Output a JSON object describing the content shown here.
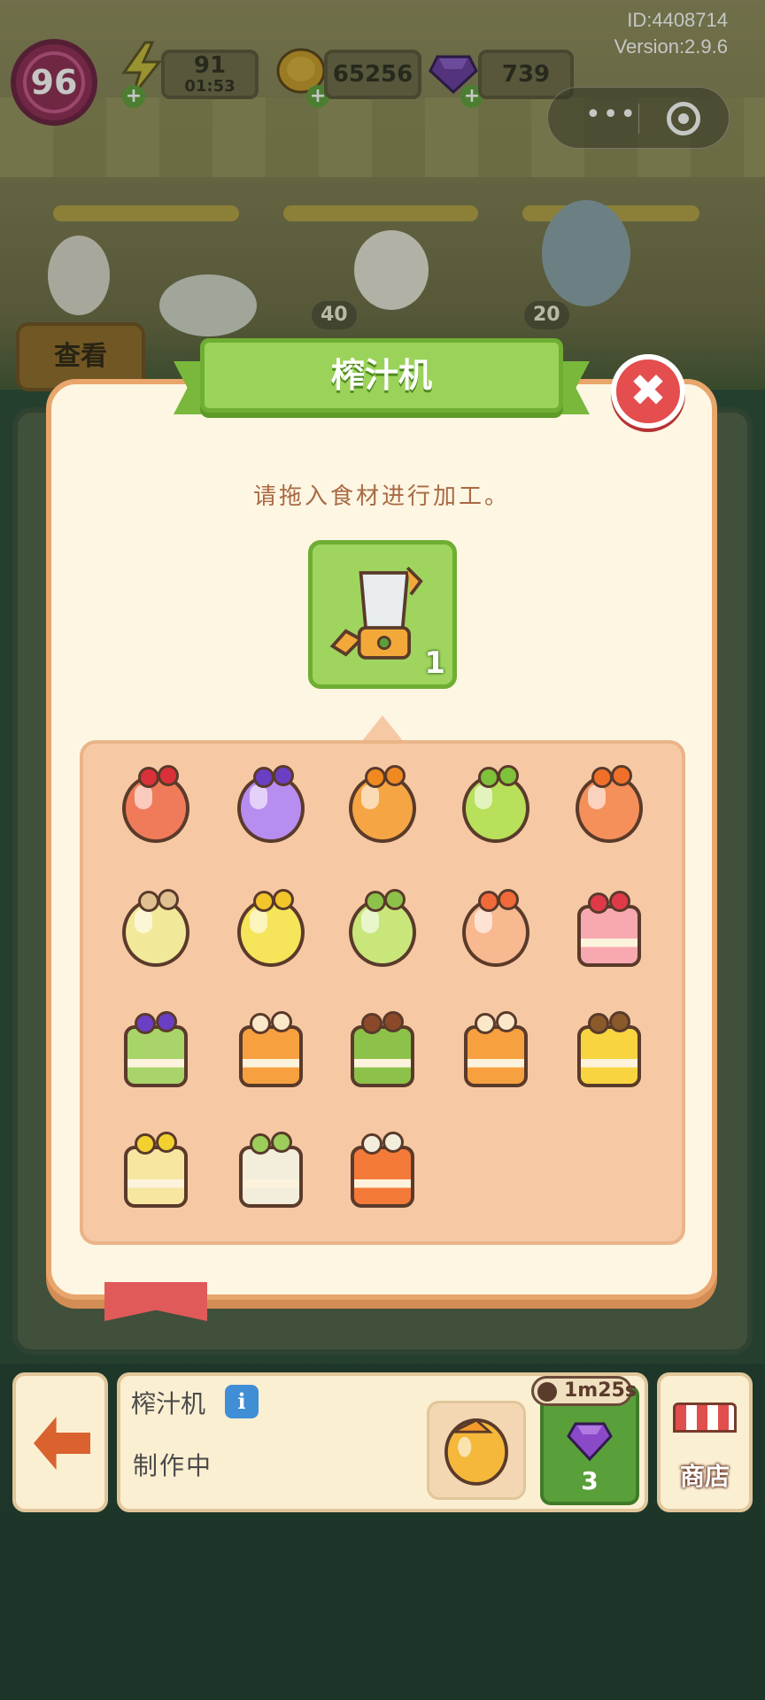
{
  "meta": {
    "id_text": "ID:4408714",
    "version_text": "Version:2.9.6"
  },
  "hud": {
    "level": "96",
    "energy": {
      "value": "91",
      "timer": "01:53"
    },
    "coins": "65256",
    "gems": "739",
    "view_button": "查看"
  },
  "scene": {
    "price_tags": [
      "40",
      "20"
    ]
  },
  "modal": {
    "title": "榨汁机",
    "close_glyph": "✖",
    "hint": "请拖入食材进行加工。",
    "machine_quantity": "1",
    "recipes": [
      {
        "kind": "cup",
        "color": "#f07b5a",
        "topping": "#d9303a"
      },
      {
        "kind": "cup",
        "color": "#b88df0",
        "topping": "#6a3fc4"
      },
      {
        "kind": "cup",
        "color": "#f6a544",
        "topping": "#f08a20"
      },
      {
        "kind": "cup",
        "color": "#b8e05a",
        "topping": "#7fc23a"
      },
      {
        "kind": "cup",
        "color": "#f5905a",
        "topping": "#f0702a"
      },
      {
        "kind": "cup",
        "color": "#f2e89a",
        "topping": "#e0c090"
      },
      {
        "kind": "cup",
        "color": "#f6e45a",
        "topping": "#f2c52a"
      },
      {
        "kind": "cup",
        "color": "#c9e67a",
        "topping": "#8cc24a"
      },
      {
        "kind": "cup",
        "color": "#f8b890",
        "topping": "#f06a3a"
      },
      {
        "kind": "cake",
        "color": "#f7a8b0",
        "topping": "#e03a4a"
      },
      {
        "kind": "cake",
        "color": "#a8d46a",
        "topping": "#6a3fc4"
      },
      {
        "kind": "cake",
        "color": "#f6a040",
        "topping": "#fbe8c8"
      },
      {
        "kind": "cake",
        "color": "#8cc24a",
        "topping": "#8a4a2a"
      },
      {
        "kind": "cake",
        "color": "#f6a040",
        "topping": "#fbe8c8"
      },
      {
        "kind": "cake",
        "color": "#f8d440",
        "topping": "#8a5a2a"
      },
      {
        "kind": "cake",
        "color": "#f7e6a0",
        "topping": "#f2d030"
      },
      {
        "kind": "cake",
        "color": "#f3eddc",
        "topping": "#9ccc5a"
      },
      {
        "kind": "cake",
        "color": "#f47a3a",
        "topping": "#f3eddc"
      }
    ]
  },
  "bottom": {
    "machine_name": "榨汁机",
    "info_glyph": "i",
    "status": "制作中",
    "timer": "1m25s",
    "speedup_cost": "3",
    "shop_label": "商店"
  },
  "colors": {
    "accent_green": "#9bd35a",
    "modal_bg": "#fdf6e3",
    "modal_border": "#e8a66c",
    "close_red": "#e44e4e",
    "hint_text": "#a96a43"
  }
}
